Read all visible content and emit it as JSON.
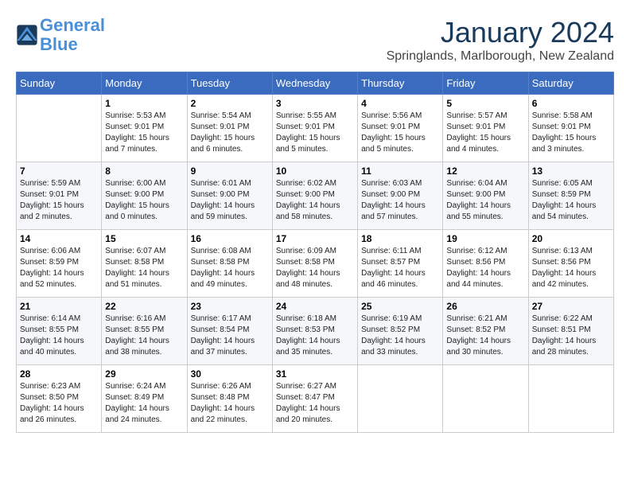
{
  "header": {
    "logo_line1": "General",
    "logo_line2": "Blue",
    "month": "January 2024",
    "location": "Springlands, Marlborough, New Zealand"
  },
  "days_of_week": [
    "Sunday",
    "Monday",
    "Tuesday",
    "Wednesday",
    "Thursday",
    "Friday",
    "Saturday"
  ],
  "weeks": [
    [
      {
        "day": "",
        "info": ""
      },
      {
        "day": "1",
        "info": "Sunrise: 5:53 AM\nSunset: 9:01 PM\nDaylight: 15 hours\nand 7 minutes."
      },
      {
        "day": "2",
        "info": "Sunrise: 5:54 AM\nSunset: 9:01 PM\nDaylight: 15 hours\nand 6 minutes."
      },
      {
        "day": "3",
        "info": "Sunrise: 5:55 AM\nSunset: 9:01 PM\nDaylight: 15 hours\nand 5 minutes."
      },
      {
        "day": "4",
        "info": "Sunrise: 5:56 AM\nSunset: 9:01 PM\nDaylight: 15 hours\nand 5 minutes."
      },
      {
        "day": "5",
        "info": "Sunrise: 5:57 AM\nSunset: 9:01 PM\nDaylight: 15 hours\nand 4 minutes."
      },
      {
        "day": "6",
        "info": "Sunrise: 5:58 AM\nSunset: 9:01 PM\nDaylight: 15 hours\nand 3 minutes."
      }
    ],
    [
      {
        "day": "7",
        "info": "Sunrise: 5:59 AM\nSunset: 9:01 PM\nDaylight: 15 hours\nand 2 minutes."
      },
      {
        "day": "8",
        "info": "Sunrise: 6:00 AM\nSunset: 9:00 PM\nDaylight: 15 hours\nand 0 minutes."
      },
      {
        "day": "9",
        "info": "Sunrise: 6:01 AM\nSunset: 9:00 PM\nDaylight: 14 hours\nand 59 minutes."
      },
      {
        "day": "10",
        "info": "Sunrise: 6:02 AM\nSunset: 9:00 PM\nDaylight: 14 hours\nand 58 minutes."
      },
      {
        "day": "11",
        "info": "Sunrise: 6:03 AM\nSunset: 9:00 PM\nDaylight: 14 hours\nand 57 minutes."
      },
      {
        "day": "12",
        "info": "Sunrise: 6:04 AM\nSunset: 9:00 PM\nDaylight: 14 hours\nand 55 minutes."
      },
      {
        "day": "13",
        "info": "Sunrise: 6:05 AM\nSunset: 8:59 PM\nDaylight: 14 hours\nand 54 minutes."
      }
    ],
    [
      {
        "day": "14",
        "info": "Sunrise: 6:06 AM\nSunset: 8:59 PM\nDaylight: 14 hours\nand 52 minutes."
      },
      {
        "day": "15",
        "info": "Sunrise: 6:07 AM\nSunset: 8:58 PM\nDaylight: 14 hours\nand 51 minutes."
      },
      {
        "day": "16",
        "info": "Sunrise: 6:08 AM\nSunset: 8:58 PM\nDaylight: 14 hours\nand 49 minutes."
      },
      {
        "day": "17",
        "info": "Sunrise: 6:09 AM\nSunset: 8:58 PM\nDaylight: 14 hours\nand 48 minutes."
      },
      {
        "day": "18",
        "info": "Sunrise: 6:11 AM\nSunset: 8:57 PM\nDaylight: 14 hours\nand 46 minutes."
      },
      {
        "day": "19",
        "info": "Sunrise: 6:12 AM\nSunset: 8:56 PM\nDaylight: 14 hours\nand 44 minutes."
      },
      {
        "day": "20",
        "info": "Sunrise: 6:13 AM\nSunset: 8:56 PM\nDaylight: 14 hours\nand 42 minutes."
      }
    ],
    [
      {
        "day": "21",
        "info": "Sunrise: 6:14 AM\nSunset: 8:55 PM\nDaylight: 14 hours\nand 40 minutes."
      },
      {
        "day": "22",
        "info": "Sunrise: 6:16 AM\nSunset: 8:55 PM\nDaylight: 14 hours\nand 38 minutes."
      },
      {
        "day": "23",
        "info": "Sunrise: 6:17 AM\nSunset: 8:54 PM\nDaylight: 14 hours\nand 37 minutes."
      },
      {
        "day": "24",
        "info": "Sunrise: 6:18 AM\nSunset: 8:53 PM\nDaylight: 14 hours\nand 35 minutes."
      },
      {
        "day": "25",
        "info": "Sunrise: 6:19 AM\nSunset: 8:52 PM\nDaylight: 14 hours\nand 33 minutes."
      },
      {
        "day": "26",
        "info": "Sunrise: 6:21 AM\nSunset: 8:52 PM\nDaylight: 14 hours\nand 30 minutes."
      },
      {
        "day": "27",
        "info": "Sunrise: 6:22 AM\nSunset: 8:51 PM\nDaylight: 14 hours\nand 28 minutes."
      }
    ],
    [
      {
        "day": "28",
        "info": "Sunrise: 6:23 AM\nSunset: 8:50 PM\nDaylight: 14 hours\nand 26 minutes."
      },
      {
        "day": "29",
        "info": "Sunrise: 6:24 AM\nSunset: 8:49 PM\nDaylight: 14 hours\nand 24 minutes."
      },
      {
        "day": "30",
        "info": "Sunrise: 6:26 AM\nSunset: 8:48 PM\nDaylight: 14 hours\nand 22 minutes."
      },
      {
        "day": "31",
        "info": "Sunrise: 6:27 AM\nSunset: 8:47 PM\nDaylight: 14 hours\nand 20 minutes."
      },
      {
        "day": "",
        "info": ""
      },
      {
        "day": "",
        "info": ""
      },
      {
        "day": "",
        "info": ""
      }
    ]
  ]
}
